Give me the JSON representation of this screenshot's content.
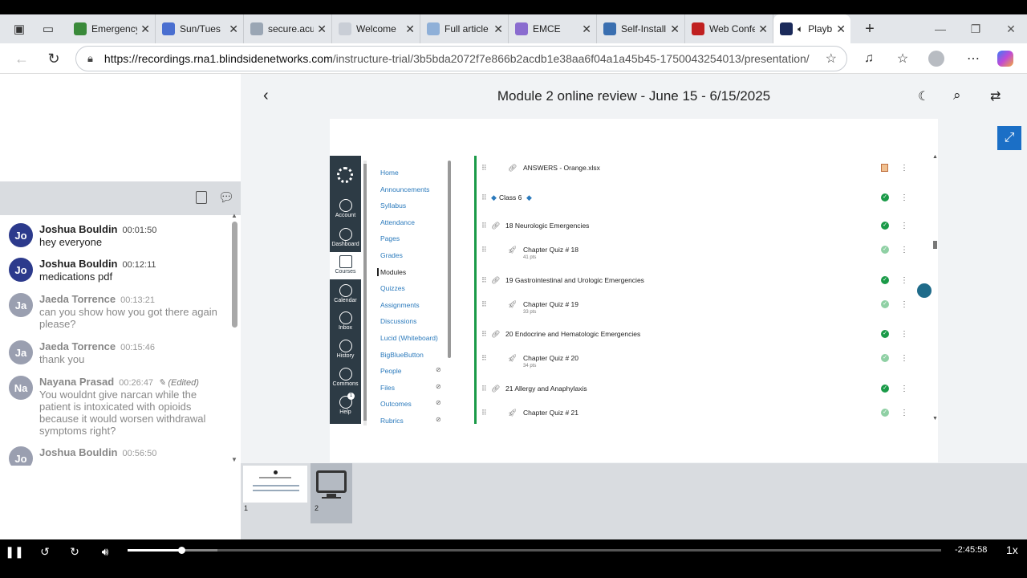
{
  "browser": {
    "tabs": [
      {
        "title": "Emergency",
        "fav": "#3a8a3a"
      },
      {
        "title": "Sun/Tues",
        "fav": "#4a6fd0"
      },
      {
        "title": "secure.acu",
        "fav": "#9aa6b4"
      },
      {
        "title": "Welcome",
        "fav": "#c9ced6"
      },
      {
        "title": "Full article",
        "fav": "#8fb0d8"
      },
      {
        "title": "EMCE",
        "fav": "#8a6ccf"
      },
      {
        "title": "Self-Install",
        "fav": "#3a6fb0"
      },
      {
        "title": "Web Confe",
        "fav": "#c02020"
      },
      {
        "title": "Playb",
        "fav": "#1b2a5a"
      }
    ],
    "url_host": "https://recordings.rna1.blindsidenetworks.com",
    "url_path": "/instructure-trial/3b5bda2072f7e866b2acdb1e38aa6f04a1a45b45-1750043254013/presentation/"
  },
  "chat": {
    "messages": [
      {
        "initials": "Jo",
        "name": "Joshua Bouldin",
        "time": "00:01:50",
        "text": "hey everyone"
      },
      {
        "initials": "Jo",
        "name": "Joshua Bouldin",
        "time": "00:12:11",
        "text": "medications pdf"
      },
      {
        "initials": "Ja",
        "name": "Jaeda Torrence",
        "time": "00:13:21",
        "text": "can you show how you got there again please?"
      },
      {
        "initials": "Ja",
        "name": "Jaeda Torrence",
        "time": "00:15:46",
        "text": "thank you"
      },
      {
        "initials": "Na",
        "name": "Nayana Prasad",
        "time": "00:26:47",
        "edited": "(Edited)",
        "text": "You wouldnt give narcan while the patient is intoxicated with opioids because it would worsen withdrawal symptoms right?"
      },
      {
        "initials": "Jo",
        "name": "Joshua Bouldin",
        "time": "00:56:50",
        "text": ""
      }
    ]
  },
  "presentation": {
    "title": "Module 2 online review - June 15 - 6/15/2025"
  },
  "slide": {
    "nav": [
      "Account",
      "Dashboard",
      "Courses",
      "Calendar",
      "Inbox",
      "History",
      "Commons",
      "Help"
    ],
    "help_badge": "1",
    "menu": [
      "Home",
      "Announcements",
      "Syllabus",
      "Attendance",
      "Pages",
      "Grades",
      "Modules",
      "Quizzes",
      "Assignments",
      "Discussions",
      "Lucid (Whiteboard)",
      "BigBlueButton",
      "People",
      "Files",
      "Outcomes",
      "Rubrics"
    ],
    "module_items": [
      {
        "text": "ANSWERS - Orange.xlsx",
        "indent": true,
        "status": "file"
      },
      {
        "text": "Class 6",
        "header": true,
        "status": "done"
      },
      {
        "text": "18 Neurologic Emergencies",
        "status": "done"
      },
      {
        "text": "Chapter Quiz # 18",
        "pts": "41 pts",
        "indent": true,
        "status": "light"
      },
      {
        "text": "19 Gastrointestinal and Urologic Emergencies",
        "status": "done"
      },
      {
        "text": "Chapter Quiz # 19",
        "pts": "33 pts",
        "indent": true,
        "status": "light"
      },
      {
        "text": "20 Endocrine and Hematologic Emergencies",
        "status": "done"
      },
      {
        "text": "Chapter Quiz # 20",
        "pts": "34 pts",
        "indent": true,
        "status": "light"
      },
      {
        "text": "21 Allergy and Anaphylaxis",
        "status": "done"
      },
      {
        "text": "Chapter Quiz # 21",
        "indent": true,
        "status": "light"
      }
    ]
  },
  "thumbnails": [
    {
      "label": "1"
    },
    {
      "label": "2"
    }
  ],
  "player": {
    "time_remaining": "-2:45:58",
    "speed": "1x",
    "progress_fraction": 0.066,
    "buffered_fraction": 0.11
  },
  "colors": {
    "accent": "#1b6fc6",
    "canvas_nav": "#2d3b45",
    "module_green": "#1a9a48"
  }
}
